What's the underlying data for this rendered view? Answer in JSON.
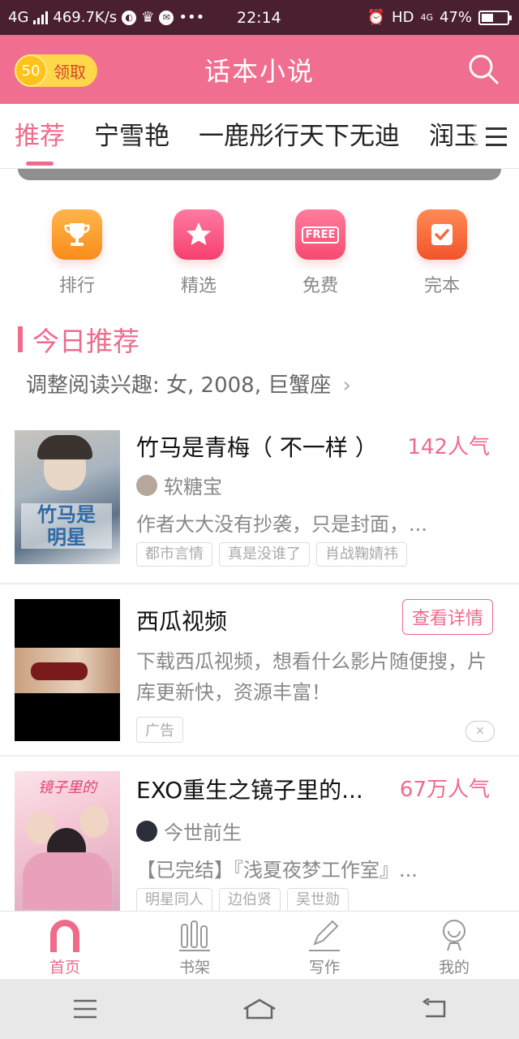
{
  "status_bar": {
    "network": "4G",
    "speed": "469.7K/s",
    "time": "22:14",
    "hd": "HD",
    "net2": "4G",
    "battery": "47%",
    "battery_level": 0.47
  },
  "header": {
    "coin_count": "50",
    "coin_label": "领取",
    "title": "话本小说",
    "search_icon": "search-icon"
  },
  "tabs": [
    {
      "label": "推荐",
      "active": true
    },
    {
      "label": "宁雪艳"
    },
    {
      "label": "一鹿彤行天下无迪"
    },
    {
      "label": "润玉"
    }
  ],
  "quick_links": [
    {
      "label": "排行",
      "icon": "trophy-icon",
      "color": "#f9a12a"
    },
    {
      "label": "精选",
      "icon": "star-icon",
      "color": "#f85a8a"
    },
    {
      "label": "免费",
      "icon": "free-icon",
      "color": "#f9577b",
      "badge": "FREE"
    },
    {
      "label": "完本",
      "icon": "check-icon",
      "color": "#f4683e"
    }
  ],
  "section": {
    "title": "今日推荐",
    "interest": "调整阅读兴趣: 女, 2008, 巨蟹座"
  },
  "books": [
    {
      "title": "竹马是青梅（ 不一样 ）",
      "popularity": "142人气",
      "author": "软糖宝",
      "desc": "作者大大没有抄袭，只是封面，...",
      "tags": [
        "都市言情",
        "真是没谁了",
        "肖战鞠婧祎"
      ]
    },
    {
      "title": "EXO重生之镜子里的...",
      "popularity": "67万人气",
      "author": "今世前生",
      "desc": "【已完结】『浅夏夜梦工作室』...",
      "tags": [
        "明星同人",
        "边伯贤",
        "吴世勋"
      ]
    }
  ],
  "ad": {
    "title": "西瓜视频",
    "button": "查看详情",
    "desc": "下载西瓜视频，想看什么影片随便搜，片库更新快，资源丰富！",
    "tag": "广告"
  },
  "bottom_nav": [
    {
      "label": "首页",
      "icon": "home-icon",
      "active": true
    },
    {
      "label": "书架",
      "icon": "bookshelf-icon"
    },
    {
      "label": "写作",
      "icon": "pen-icon"
    },
    {
      "label": "我的",
      "icon": "profile-icon"
    }
  ],
  "system_nav": [
    "menu-icon",
    "home-outline-icon",
    "back-icon"
  ],
  "colors": {
    "accent": "#ef6b8c",
    "header": "#f06e8f",
    "statusbar": "#4a2030"
  }
}
